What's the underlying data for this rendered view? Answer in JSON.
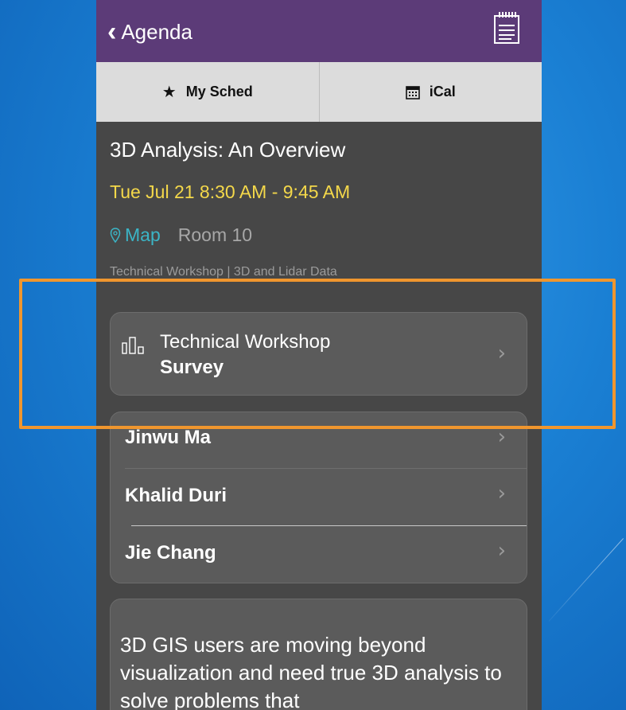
{
  "navbar": {
    "back_label": "Agenda",
    "back_icon": "chevron-left-icon",
    "notes_icon": "notepad-icon",
    "bg_color": "#5c3b78"
  },
  "segments": [
    {
      "label": "My Sched",
      "icon": "star-icon"
    },
    {
      "label": "iCal",
      "icon": "calendar-icon"
    }
  ],
  "session": {
    "title": "3D Analysis: An Overview",
    "time": "Tue Jul 21 8:30 AM - 9:45 AM",
    "map_label": "Map",
    "room": "Room 10",
    "track": "Technical Workshop | 3D and Lidar Data"
  },
  "survey": {
    "label_line1": "Technical Workshop",
    "label_line2": "Survey",
    "icon": "bar-chart-icon"
  },
  "speakers": [
    "Jinwu Ma",
    "Khalid Duri",
    "Jie Chang"
  ],
  "description": "3D GIS users are moving beyond visualization and need true 3D analysis to solve problems that",
  "colors": {
    "time": "#f4d84a",
    "map_link": "#3bb5c6",
    "highlight": "#f0962e"
  }
}
